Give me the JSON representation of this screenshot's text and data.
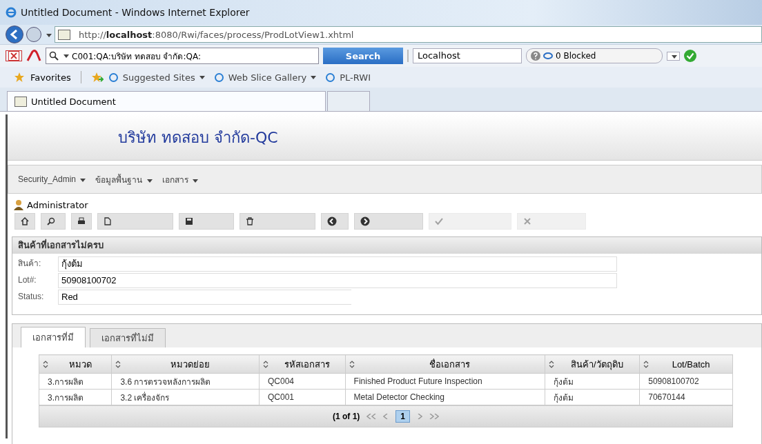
{
  "window": {
    "title": "Untitled Document - Windows Internet Explorer"
  },
  "address_bar": {
    "url_prefix": "http://",
    "url_host": "localhost",
    "url_rest": ":8080/Rwi/faces/process/ProdLotView1.xhtml"
  },
  "search_toolbar": {
    "query": "C001:QA:บริษัท ทดสอบ จำกัด:QA:",
    "search_button": "Search",
    "site": "Localhost",
    "blocked": "0 Blocked"
  },
  "favorites_bar": {
    "favorites": "Favorites",
    "links": [
      {
        "label": "Suggested Sites",
        "dropdown": true
      },
      {
        "label": "Web Slice Gallery",
        "dropdown": true
      },
      {
        "label": "PL-RWI",
        "dropdown": false
      }
    ]
  },
  "browser_tabs": [
    {
      "label": "Untitled Document",
      "selected": true
    },
    {
      "selected": false
    }
  ],
  "page": {
    "company": "บริษัท ทดสอบ จำกัด-QC",
    "menu": [
      "Security_Admin",
      "ข้อมูลพื้นฐาน",
      "เอกสาร"
    ],
    "user": "Administrator",
    "toolbar": [
      {
        "kind": "home",
        "enabled": true
      },
      {
        "kind": "search",
        "enabled": true
      },
      {
        "kind": "print",
        "enabled": true
      },
      {
        "kind": "new",
        "enabled": true
      },
      {
        "kind": "save",
        "enabled": true
      },
      {
        "kind": "delete",
        "enabled": true
      },
      {
        "kind": "back",
        "enabled": true
      },
      {
        "kind": "forward",
        "enabled": true
      },
      {
        "kind": "check",
        "enabled": false
      },
      {
        "kind": "cancel",
        "enabled": false
      }
    ],
    "panel": {
      "title": "สินค้าที่เอกสารไม่ครบ",
      "fields": [
        {
          "label": "สินค้า:",
          "value": "กุ้งต้ม"
        },
        {
          "label": "Lot#:",
          "value": "50908100702"
        },
        {
          "label": "Status:",
          "value": "Red"
        }
      ]
    },
    "tabs": [
      {
        "label": "เอกสารที่มี",
        "selected": true
      },
      {
        "label": "เอกสารที่ไม่มี",
        "selected": false
      }
    ],
    "table": {
      "columns": [
        "หมวด",
        "หมวดย่อย",
        "รหัสเอกสาร",
        "ชื่อเอกสาร",
        "สินค้า/วัตถุดิบ",
        "Lot/Batch"
      ],
      "rows": [
        [
          "3.การผลิต",
          "3.6 การตรวจหลังการผลิต",
          "QC004",
          "Finished Product Future Inspection",
          "กุ้งต้ม",
          "50908100702"
        ],
        [
          "3.การผลิต",
          "3.2 เครื่องจักร",
          "QC001",
          "Metal Detector Checking",
          "กุ้งต้ม",
          "70670144"
        ]
      ],
      "paginator": {
        "summary": "(1 of 1)",
        "pages": [
          {
            "label": "1",
            "selected": true
          }
        ]
      }
    }
  }
}
